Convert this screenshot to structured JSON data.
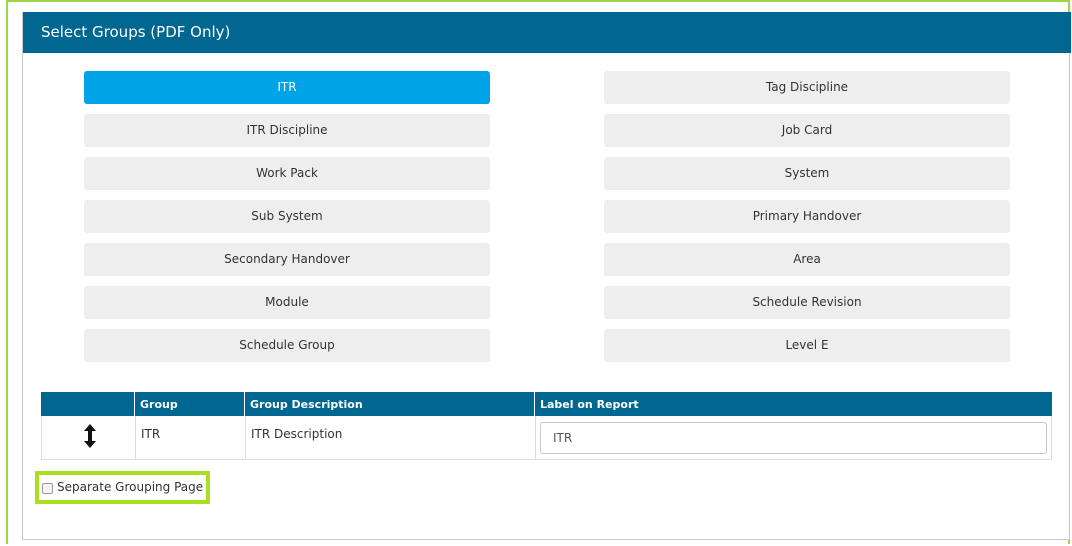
{
  "panel": {
    "title": "Select Groups (PDF Only)"
  },
  "groups": {
    "left": [
      "ITR",
      "ITR Discipline",
      "Work Pack",
      "Sub System",
      "Secondary Handover",
      "Module",
      "Schedule Group"
    ],
    "right": [
      "Tag Discipline",
      "Job Card",
      "System",
      "Primary Handover",
      "Area",
      "Schedule Revision",
      "Level E"
    ],
    "selected": "ITR"
  },
  "table": {
    "headers": {
      "drag": "",
      "group": "Group",
      "description": "Group Description",
      "label": "Label on Report"
    },
    "rows": [
      {
        "group": "ITR",
        "description": "ITR Description",
        "label_value": "ITR"
      }
    ]
  },
  "options": {
    "separate_grouping_label": "Separate Grouping Page",
    "separate_grouping_checked": false
  },
  "colors": {
    "header": "#016690",
    "active": "#00a2e8",
    "highlight": "#a8e020"
  },
  "icons": {
    "drag": "up-down-arrow-icon"
  }
}
